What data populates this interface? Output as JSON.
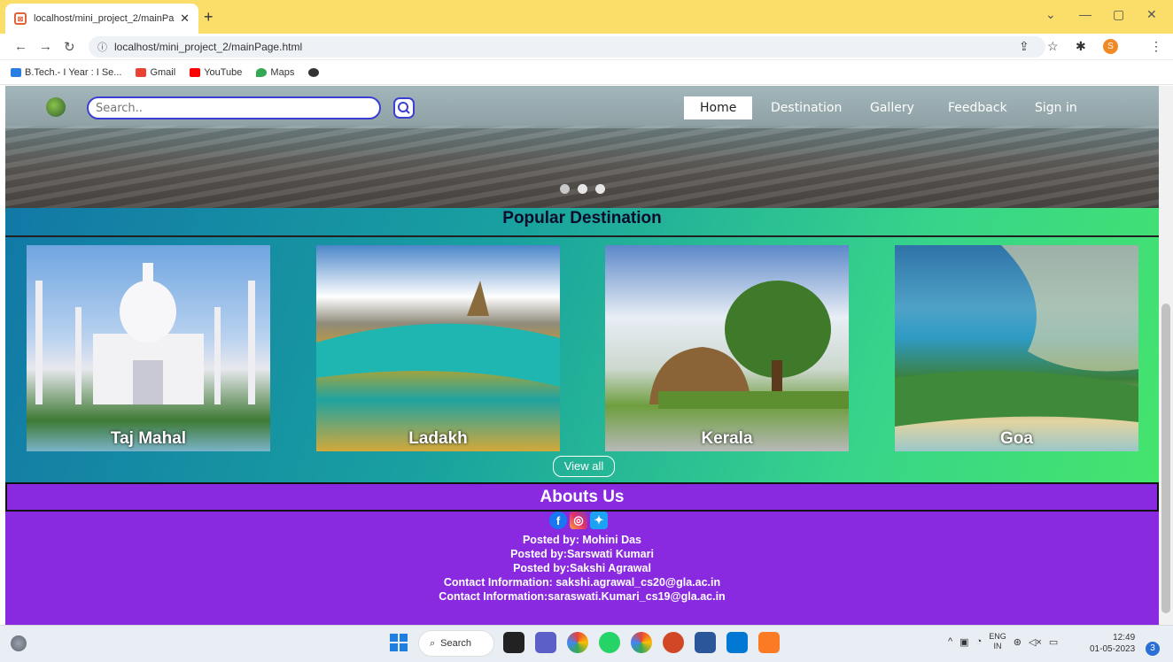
{
  "browser": {
    "tab_title": "localhost/mini_project_2/mainPa",
    "url": "localhost/mini_project_2/mainPage.html",
    "profile_initial": "S",
    "bookmarks": [
      "B.Tech.- I Year : I Se...",
      "Gmail",
      "YouTube",
      "Maps"
    ]
  },
  "header": {
    "search_placeholder": "Search..",
    "nav": [
      "Home",
      "Destination",
      "Gallery",
      "Feedback",
      "Sign in"
    ],
    "active_nav": "Home"
  },
  "popular": {
    "title": "Popular Destination",
    "destinations": [
      "Taj Mahal",
      "Ladakh",
      "Kerala",
      "Goa"
    ],
    "view_all": "View all"
  },
  "about": {
    "title": "Abouts Us",
    "credits": [
      "Posted by: Mohini Das",
      "Posted by:Sarswati Kumari",
      "Posted by:Sakshi Agrawal",
      "Contact Information: sakshi.agrawal_cs20@gla.ac.in",
      "Contact Information:saraswati.Kumari_cs19@gla.ac.in"
    ]
  },
  "taskbar": {
    "search_label": "Search",
    "lang": "ENG",
    "region": "IN",
    "time": "12:49",
    "date": "01-05-2023",
    "notifications": "3"
  },
  "colors": {
    "tabbar": "#fbdd6a",
    "popular_start": "#1278a6",
    "popular_end": "#45e46c",
    "about_bg": "#8a2ae0"
  }
}
